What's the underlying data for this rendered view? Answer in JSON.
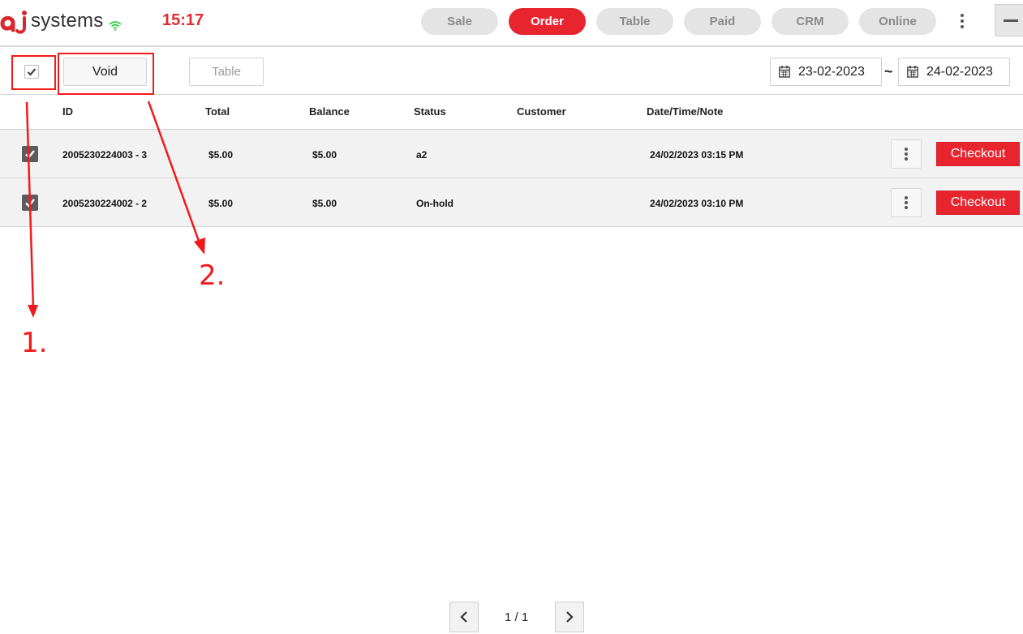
{
  "header": {
    "logo_text": "systems",
    "clock": "15:17",
    "nav": [
      {
        "label": "Sale",
        "active": false
      },
      {
        "label": "Order",
        "active": true
      },
      {
        "label": "Table",
        "active": false
      },
      {
        "label": "Paid",
        "active": false
      },
      {
        "label": "CRM",
        "active": false
      },
      {
        "label": "Online",
        "active": false
      }
    ]
  },
  "toolbar": {
    "void_label": "Void",
    "table_label": "Table",
    "date_from": "23-02-2023",
    "date_separator": "~",
    "date_to": "24-02-2023"
  },
  "table": {
    "columns": [
      "ID",
      "Total",
      "Balance",
      "Status",
      "Customer",
      "Date/Time/Note"
    ],
    "rows": [
      {
        "id": "2005230224003 - 3",
        "total": "$5.00",
        "balance": "$5.00",
        "status": "a2",
        "customer": "",
        "datetime": "24/02/2023 03:15 PM",
        "action": "Checkout",
        "checked": true
      },
      {
        "id": "2005230224002 - 2",
        "total": "$5.00",
        "balance": "$5.00",
        "status": "On-hold",
        "customer": "",
        "datetime": "24/02/2023 03:10 PM",
        "action": "Checkout",
        "checked": true
      }
    ]
  },
  "pagination": {
    "text": "1 / 1"
  },
  "annotations": {
    "label_1": "1.",
    "label_2": "2."
  },
  "colors": {
    "accent": "#e8242f",
    "annotation": "#f21a1a",
    "nav_inactive": "#e4e4e4"
  }
}
